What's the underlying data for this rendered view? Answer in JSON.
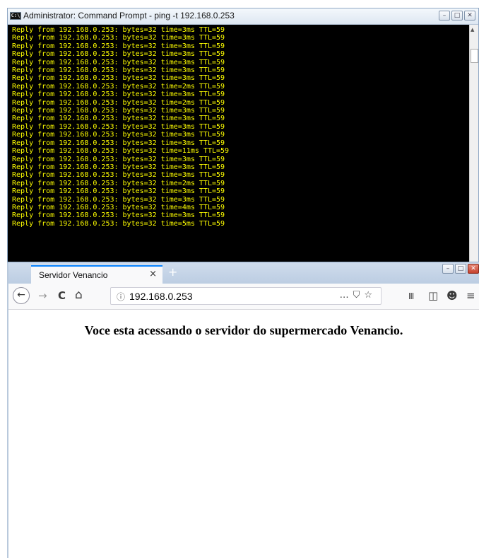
{
  "cmd": {
    "title": "Administrator: Command Prompt - ping  -t 192.168.0.253",
    "icon_text": "C:\\",
    "lines": [
      "Reply from 192.168.0.253: bytes=32 time=3ms TTL=59",
      "Reply from 192.168.0.253: bytes=32 time=3ms TTL=59",
      "Reply from 192.168.0.253: bytes=32 time=3ms TTL=59",
      "Reply from 192.168.0.253: bytes=32 time=3ms TTL=59",
      "Reply from 192.168.0.253: bytes=32 time=3ms TTL=59",
      "Reply from 192.168.0.253: bytes=32 time=3ms TTL=59",
      "Reply from 192.168.0.253: bytes=32 time=3ms TTL=59",
      "Reply from 192.168.0.253: bytes=32 time=2ms TTL=59",
      "Reply from 192.168.0.253: bytes=32 time=3ms TTL=59",
      "Reply from 192.168.0.253: bytes=32 time=2ms TTL=59",
      "Reply from 192.168.0.253: bytes=32 time=3ms TTL=59",
      "Reply from 192.168.0.253: bytes=32 time=3ms TTL=59",
      "Reply from 192.168.0.253: bytes=32 time=3ms TTL=59",
      "Reply from 192.168.0.253: bytes=32 time=3ms TTL=59",
      "Reply from 192.168.0.253: bytes=32 time=3ms TTL=59",
      "Reply from 192.168.0.253: bytes=32 time=11ms TTL=59",
      "Reply from 192.168.0.253: bytes=32 time=3ms TTL=59",
      "Reply from 192.168.0.253: bytes=32 time=3ms TTL=59",
      "Reply from 192.168.0.253: bytes=32 time=3ms TTL=59",
      "Reply from 192.168.0.253: bytes=32 time=2ms TTL=59",
      "Reply from 192.168.0.253: bytes=32 time=3ms TTL=59",
      "Reply from 192.168.0.253: bytes=32 time=3ms TTL=59",
      "Reply from 192.168.0.253: bytes=32 time=4ms TTL=59",
      "Reply from 192.168.0.253: bytes=32 time=3ms TTL=59",
      "Reply from 192.168.0.253: bytes=32 time=5ms TTL=59"
    ],
    "colors": {
      "background": "#000000",
      "text": "#ffff00"
    },
    "window_buttons": {
      "minimize": "–",
      "maximize": "□",
      "close": "✕"
    }
  },
  "browser": {
    "tab_label": "Servidor Venancio",
    "tab_close": "×",
    "new_tab": "+",
    "url": "192.168.0.253",
    "url_info_icon": "ⓘ",
    "page_actions": [
      "…",
      "⛉",
      "☆"
    ],
    "toolbar_icons": {
      "back": "←",
      "forward": "→",
      "reload": "C",
      "home": "⌂",
      "library": "Ⅲ",
      "sidebar": "◫",
      "account": "☻",
      "menu": "≡"
    },
    "window_buttons": {
      "minimize": "–",
      "maximize": "□",
      "close": "✕"
    },
    "accent_color": "#0a84ff",
    "page_heading": "Voce esta acessando o servidor do supermercado Venancio."
  }
}
